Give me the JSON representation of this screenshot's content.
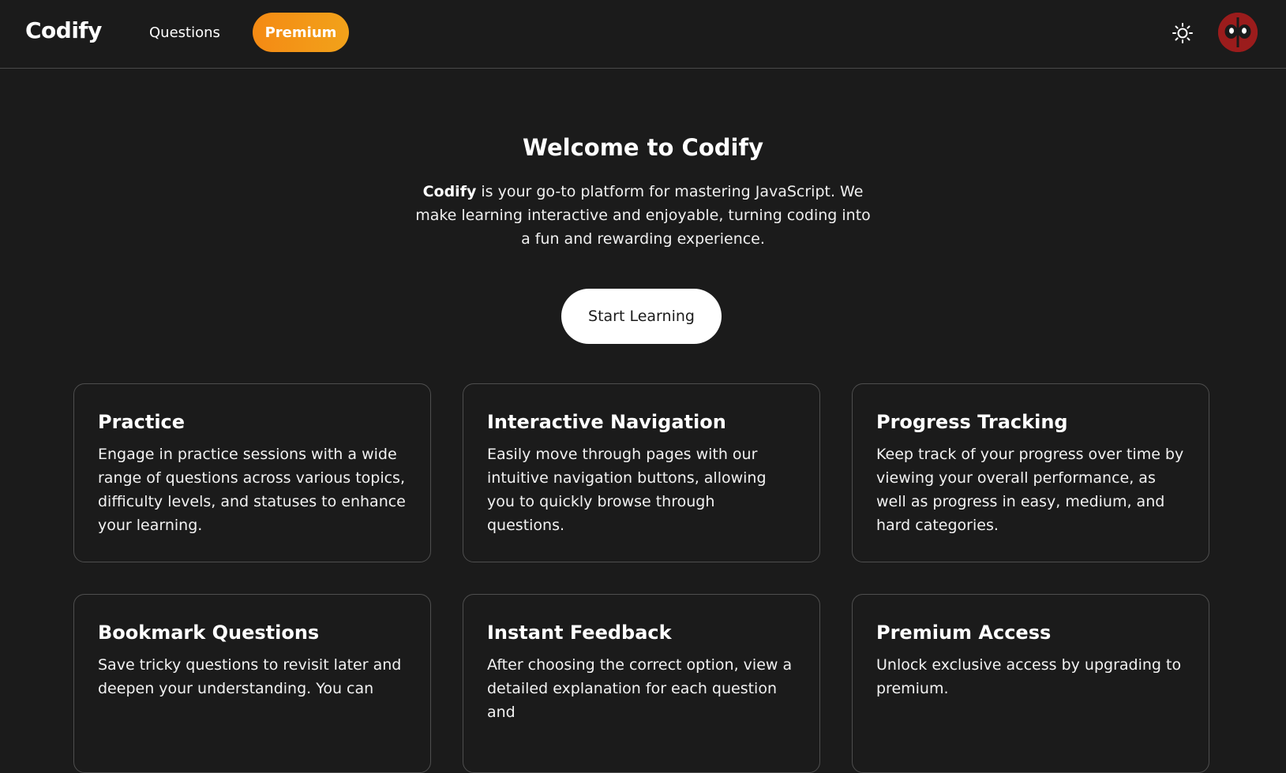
{
  "nav": {
    "logo": "Codify",
    "questions_label": "Questions",
    "premium_label": "Premium",
    "theme_icon": "sun-icon",
    "avatar_icon": "deadpool-avatar"
  },
  "hero": {
    "title": "Welcome to Codify",
    "desc_bold": "Codify",
    "desc_rest": " is your go-to platform for mastering JavaScript. We make learning interactive and enjoyable, turning coding into a fun and rewarding experience.",
    "cta_label": "Start Learning"
  },
  "features": [
    {
      "title": "Practice",
      "text": "Engage in practice sessions with a wide range of questions across various topics, difficulty levels, and statuses to enhance your learning."
    },
    {
      "title": "Interactive Navigation",
      "text": "Easily move through pages with our intuitive navigation buttons, allowing you to quickly browse through questions."
    },
    {
      "title": "Progress Tracking",
      "text": "Keep track of your progress over time by viewing your overall performance, as well as progress in easy, medium, and hard categories."
    },
    {
      "title": "Bookmark Questions",
      "text": "Save tricky questions to revisit later and deepen your understanding. You can"
    },
    {
      "title": "Instant Feedback",
      "text": "After choosing the correct option, view a detailed explanation for each question and"
    },
    {
      "title": "Premium Access",
      "text": "Unlock exclusive access by upgrading to premium."
    }
  ],
  "colors": {
    "background": "#1b1b1b",
    "accent": "#f48a14",
    "avatar": "#9b1c1c"
  }
}
